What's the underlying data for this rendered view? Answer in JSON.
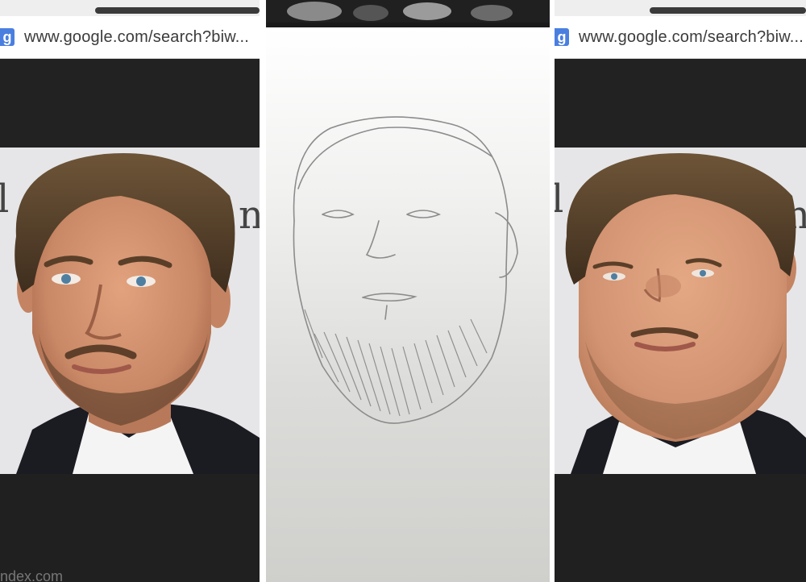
{
  "left_panel": {
    "url": "www.google.com/search?biw...",
    "footer_text": "ndex.com"
  },
  "right_panel": {
    "url": "www.google.com/search?biw..."
  },
  "icons": {
    "browser": "google-g-icon"
  },
  "colors": {
    "google_blue": "#4a7fe0",
    "dark_band": "#222222"
  }
}
